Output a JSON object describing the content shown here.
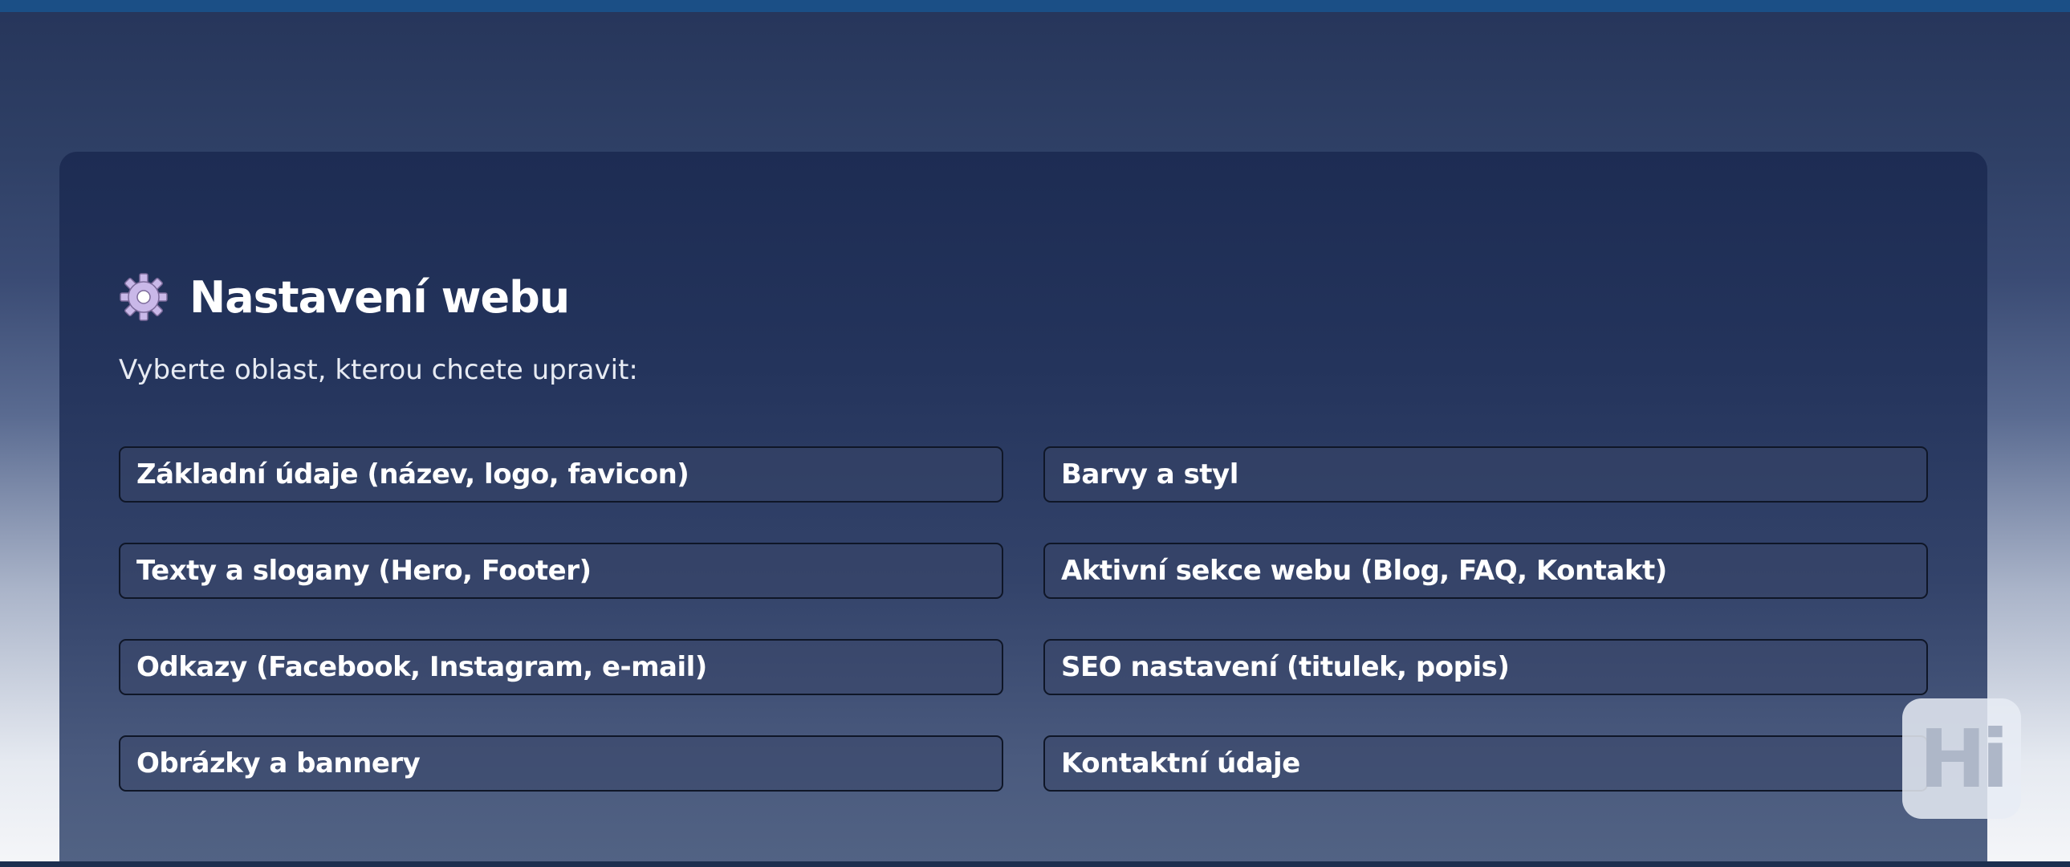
{
  "header": {
    "title": "Nastavení webu",
    "icon": "gear-icon",
    "subtitle": "Vyberte oblast, kterou chcete upravit:"
  },
  "options": [
    {
      "label": "Základní údaje (název, logo, favicon)"
    },
    {
      "label": "Barvy a styl"
    },
    {
      "label": "Texty a slogany (Hero, Footer)"
    },
    {
      "label": "Aktivní sekce webu (Blog, FAQ, Kontakt)"
    },
    {
      "label": "Odkazy (Facebook, Instagram, e-mail)"
    },
    {
      "label": "SEO nastavení (titulek, popis)"
    },
    {
      "label": "Obrázky a bannery"
    },
    {
      "label": "Kontaktní údaje"
    }
  ],
  "badge": {
    "label": "Hi"
  },
  "colors": {
    "top_bar": "#1b4f86",
    "panel": "#1d2c53",
    "gear": "#c9b8e8",
    "text": "#ffffff"
  }
}
